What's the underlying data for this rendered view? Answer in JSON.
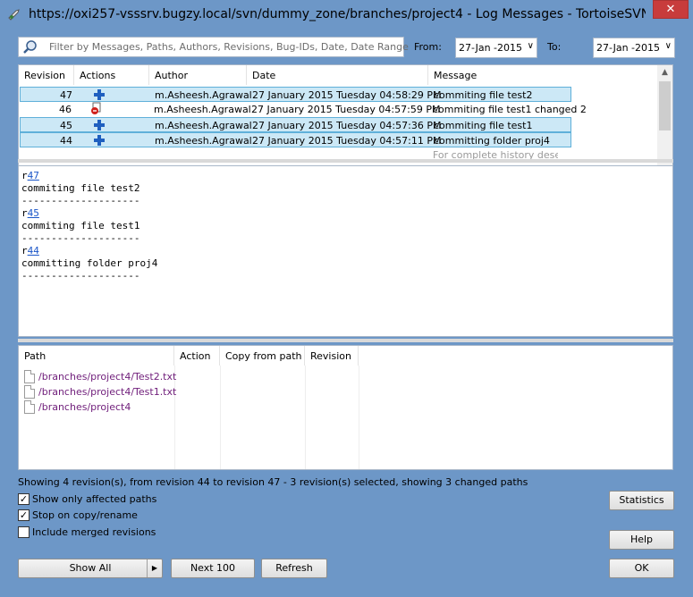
{
  "window": {
    "title": "https://oxi257-vsssrv.bugzy.local/svn/dummy_zone/branches/project4 - Log Messages - TortoiseSVN",
    "close_glyph": "✕"
  },
  "filter": {
    "placeholder": "Filter by Messages, Paths, Authors, Revisions, Bug-IDs, Date, Date Range",
    "from_label": "From:",
    "from_value": "27-Jan -2015",
    "to_label": "To:",
    "to_value": "27-Jan -2015"
  },
  "revisions": {
    "columns": [
      "Revision",
      "Actions",
      "Author",
      "Date",
      "Message"
    ],
    "rows": [
      {
        "revision": "47",
        "action": "add",
        "author": "m.Asheesh.Agrawal",
        "date": "27 January 2015 Tuesday 04:58:29 PM",
        "message": "commiting file test2",
        "selected": true
      },
      {
        "revision": "46",
        "action": "delete",
        "author": "m.Asheesh.Agrawal",
        "date": "27 January 2015 Tuesday 04:57:59 PM",
        "message": "commiting file test1 changed 2",
        "selected": false
      },
      {
        "revision": "45",
        "action": "add",
        "author": "m.Asheesh.Agrawal",
        "date": "27 January 2015 Tuesday 04:57:36 PM",
        "message": "commiting file test1",
        "selected": true
      },
      {
        "revision": "44",
        "action": "add",
        "author": "m.Asheesh.Agrawal",
        "date": "27 January 2015 Tuesday 04:57:11 PM",
        "message": "committing folder proj4",
        "selected": true
      }
    ],
    "footer_hint": "For complete history desele"
  },
  "message_pane": {
    "entries": [
      {
        "r_prefix": "r",
        "rev": "47",
        "text": "commiting file test2",
        "sep": "--------------------"
      },
      {
        "r_prefix": "r",
        "rev": "45",
        "text": "commiting file test1",
        "sep": "--------------------"
      },
      {
        "r_prefix": "r",
        "rev": "44",
        "text": "committing folder proj4",
        "sep": "--------------------"
      }
    ]
  },
  "paths": {
    "columns": [
      "Path",
      "Action",
      "Copy from path",
      "Revision"
    ],
    "rows": [
      "/branches/project4/Test2.txt",
      "/branches/project4/Test1.txt",
      "/branches/project4"
    ]
  },
  "status_text": "Showing 4 revision(s), from revision 44 to revision 47 - 3 revision(s) selected, showing 3 changed paths",
  "options": {
    "show_affected": {
      "label": "Show only affected paths",
      "checked": true
    },
    "stop_on_copy": {
      "label": "Stop on copy/rename",
      "checked": true
    },
    "include_merged": {
      "label": "Include merged revisions",
      "checked": false
    }
  },
  "buttons": {
    "show_all": "Show All",
    "next_100": "Next 100",
    "refresh": "Refresh",
    "statistics": "Statistics",
    "help": "Help",
    "ok": "OK"
  },
  "colors": {
    "selection": "#cce8f6",
    "link": "#1a55c8",
    "path": "#6f1d7a",
    "frame": "#6d97c7"
  }
}
